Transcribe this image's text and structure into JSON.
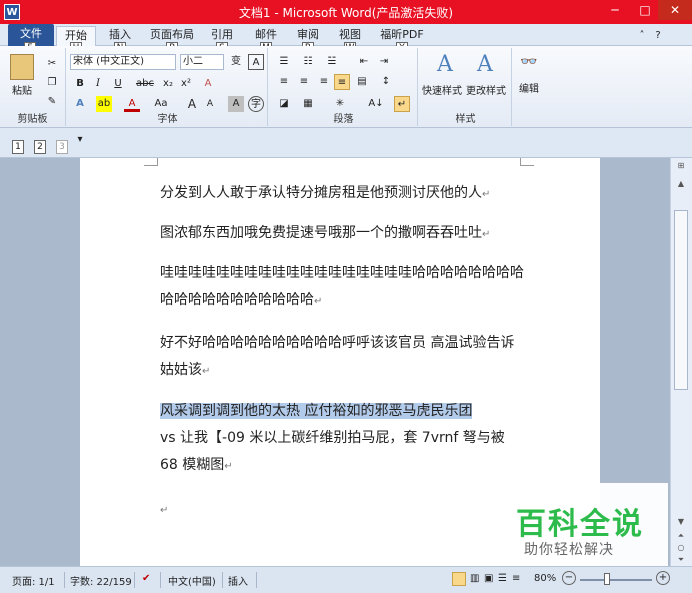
{
  "window": {
    "app_icon": "W",
    "title": "文档1 - Microsoft Word(产品激活失败)",
    "min": "─",
    "max": "□",
    "close": "✕"
  },
  "tabs": [
    {
      "label": "文件",
      "key": "F"
    },
    {
      "label": "开始",
      "key": "H"
    },
    {
      "label": "插入",
      "key": "N"
    },
    {
      "label": "页面布局",
      "key": "P"
    },
    {
      "label": "引用",
      "key": "S"
    },
    {
      "label": "邮件",
      "key": "M"
    },
    {
      "label": "审阅",
      "key": "R"
    },
    {
      "label": "视图",
      "key": "W"
    },
    {
      "label": "福昕PDF",
      "key": "Y"
    }
  ],
  "ribbon": {
    "clipboard": {
      "label": "剪贴板",
      "paste": "粘贴"
    },
    "font": {
      "label": "字体",
      "font_name": "宋体 (中文正文)",
      "font_size": "小二",
      "bold": "B",
      "italic": "I",
      "underline": "U",
      "strike": "abc",
      "sub": "x₂",
      "sup": "x²",
      "clear": "A",
      "text_effect": "A",
      "highlight": "ab",
      "font_color": "A",
      "change_case": "Aa",
      "grow": "A",
      "shrink": "A",
      "phonetic": "变",
      "char_border": "A",
      "char_shade": "A",
      "enclose": "字"
    },
    "paragraph": {
      "label": "段落",
      "sort": "A↓",
      "show_marks": "↵"
    },
    "styles": {
      "label": "样式",
      "quick": "快速样式",
      "change": "更改样式"
    },
    "editing": {
      "label": "编辑"
    }
  },
  "qat": [
    "1",
    "2",
    "3"
  ],
  "doc": {
    "p1": "分发到人人敢于承认特分摊房租是他预测讨厌他的人",
    "p2": "图浓郁东西加哦免费提速号哦那一个的撒啊吞吞吐吐",
    "p3": "哇哇哇哇哇哇哇哇哇哇哇哇哇哇哇哇哇哇哈哈哈哈哈哈哈哈哈哈哈哈哈哈哈哈哈哈哈",
    "p4": "好不好哈哈哈哈哈哈哈哈哈哈呼呼该该官员  高温试验告诉姑姑该",
    "p5_sel": "风采调到调到他的太热 应付裕如的邪恶马虎民乐团",
    "p5_rest1": "vs 让我【-09 米以上碳纤维别拍马屁，套 7vrnf 弩与被",
    "p5_rest2": "68 模糊图",
    "mark": "↵"
  },
  "watermark": {
    "title": "百科全说",
    "sub": "助你轻松解决"
  },
  "status": {
    "page": "页面: 1/1",
    "words": "字数: 22/159",
    "lang": "中文(中国)",
    "mode": "插入",
    "zoom": "80%"
  }
}
